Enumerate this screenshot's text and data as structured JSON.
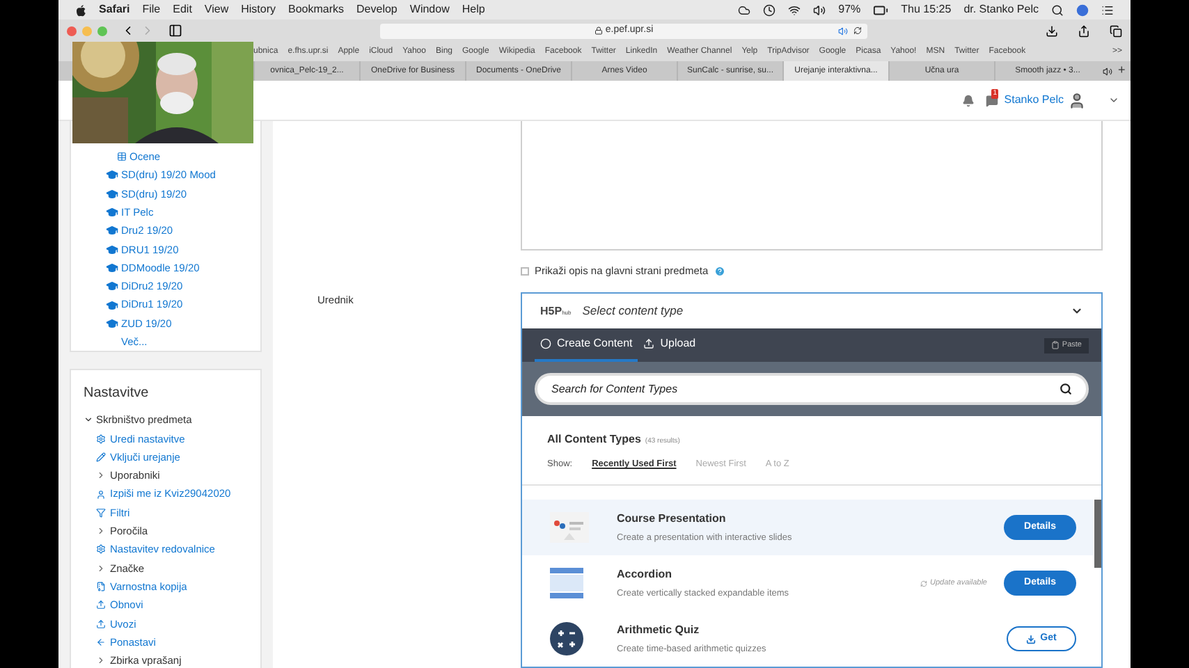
{
  "menu_bar": {
    "app": "Safari",
    "menus": [
      "File",
      "Edit",
      "View",
      "History",
      "Bookmarks",
      "Develop",
      "Window",
      "Help"
    ],
    "battery": "97%",
    "clock": "Thu 15:25",
    "user": "dr. Stanko Pelc"
  },
  "toolbar": {
    "address": "e.pef.upr.si"
  },
  "bookmarks": [
    "ubnica",
    "e.fhs.upr.si",
    "Apple",
    "iCloud",
    "Yahoo",
    "Bing",
    "Google",
    "Wikipedia",
    "Facebook",
    "Twitter",
    "LinkedIn",
    "Weather Channel",
    "Yelp",
    "TripAdvisor",
    "Google",
    "Picasa",
    "Yahoo!",
    "MSN",
    "Twitter",
    "Facebook"
  ],
  "bookmarks_more": ">>",
  "tabs": [
    {
      "label": "ovnica_Pelc-19_2...",
      "selected": false
    },
    {
      "label": "OneDrive for Business",
      "selected": false
    },
    {
      "label": "Documents - OneDrive",
      "selected": false
    },
    {
      "label": "Arnes Video",
      "selected": false
    },
    {
      "label": "SunCalc - sunrise, su...",
      "selected": false
    },
    {
      "label": "Urejanje interaktivna...",
      "selected": true
    },
    {
      "label": "Učna ura",
      "selected": false
    },
    {
      "label": "Smooth jazz • 3...",
      "selected": false
    }
  ],
  "new_tab": "+",
  "header": {
    "user": "Stanko Pelc",
    "message_count": "1"
  },
  "courses": [
    {
      "label": "Ocene",
      "kind": "grades"
    },
    {
      "label": "SD(dru) 19/20 Mood",
      "kind": "course"
    },
    {
      "label": "SD(dru) 19/20",
      "kind": "course"
    },
    {
      "label": "IT Pelc",
      "kind": "course"
    },
    {
      "label": "Dru2 19/20",
      "kind": "course"
    },
    {
      "label": "DRU1 19/20",
      "kind": "course"
    },
    {
      "label": "DDMoodle 19/20",
      "kind": "course"
    },
    {
      "label": "DiDru2 19/20",
      "kind": "course"
    },
    {
      "label": "DiDru1 19/20",
      "kind": "course"
    },
    {
      "label": "ZUD 19/20",
      "kind": "course"
    },
    {
      "label": "Več...",
      "kind": "more"
    }
  ],
  "settings": {
    "title": "Nastavitve",
    "root": {
      "label": "Skrbništvo predmeta",
      "expanded": true,
      "children": [
        {
          "label": "Uredi nastavitve",
          "kind": "gear"
        },
        {
          "label": "Vključi urejanje",
          "kind": "pencil"
        },
        {
          "label": "Uporabniki",
          "kind": "folder"
        },
        {
          "label": "Izpiši me iz Kviz29042020",
          "kind": "user"
        },
        {
          "label": "Filtri",
          "kind": "filter"
        },
        {
          "label": "Poročila",
          "kind": "folder"
        },
        {
          "label": "Nastavitev redovalnice",
          "kind": "gear"
        },
        {
          "label": "Značke",
          "kind": "folder"
        },
        {
          "label": "Varnostna kopija",
          "kind": "file"
        },
        {
          "label": "Obnovi",
          "kind": "upload"
        },
        {
          "label": "Uvozi",
          "kind": "upload"
        },
        {
          "label": "Ponastavi",
          "kind": "back"
        },
        {
          "label": "Zbirka vprašanj",
          "kind": "folder"
        }
      ]
    }
  },
  "form": {
    "checkbox": {
      "label": "Prikaži opis na glavni strani predmeta",
      "checked": false
    },
    "editor_label": "Urednik"
  },
  "h5p": {
    "logo": "H5P",
    "logo_sub": "hub",
    "placeholder": "Select content type",
    "tabs": [
      {
        "label": "Create Content",
        "selected": true
      },
      {
        "label": "Upload",
        "selected": false
      }
    ],
    "paste": "Paste",
    "search_placeholder": "Search for Content Types",
    "list_title": "All Content Types",
    "count": "(43 results)",
    "show_label": "Show:",
    "sort": [
      {
        "label": "Recently Used First",
        "selected": true
      },
      {
        "label": "Newest First",
        "selected": false
      },
      {
        "label": "A to Z",
        "selected": false
      }
    ],
    "items": [
      {
        "title": "Course Presentation",
        "description": "Create a presentation with interactive slides",
        "kind": "presentation",
        "selected": true,
        "action": {
          "kind": "details",
          "label": "Details"
        }
      },
      {
        "title": "Accordion",
        "description": "Create vertically stacked expandable items",
        "kind": "accordion",
        "selected": false,
        "update": "Update available",
        "action": {
          "kind": "details",
          "label": "Details"
        }
      },
      {
        "title": "Arithmetic Quiz",
        "description": "Create time-based arithmetic quizzes",
        "kind": "math",
        "selected": false,
        "action": {
          "kind": "get",
          "label": "Get"
        }
      }
    ]
  }
}
